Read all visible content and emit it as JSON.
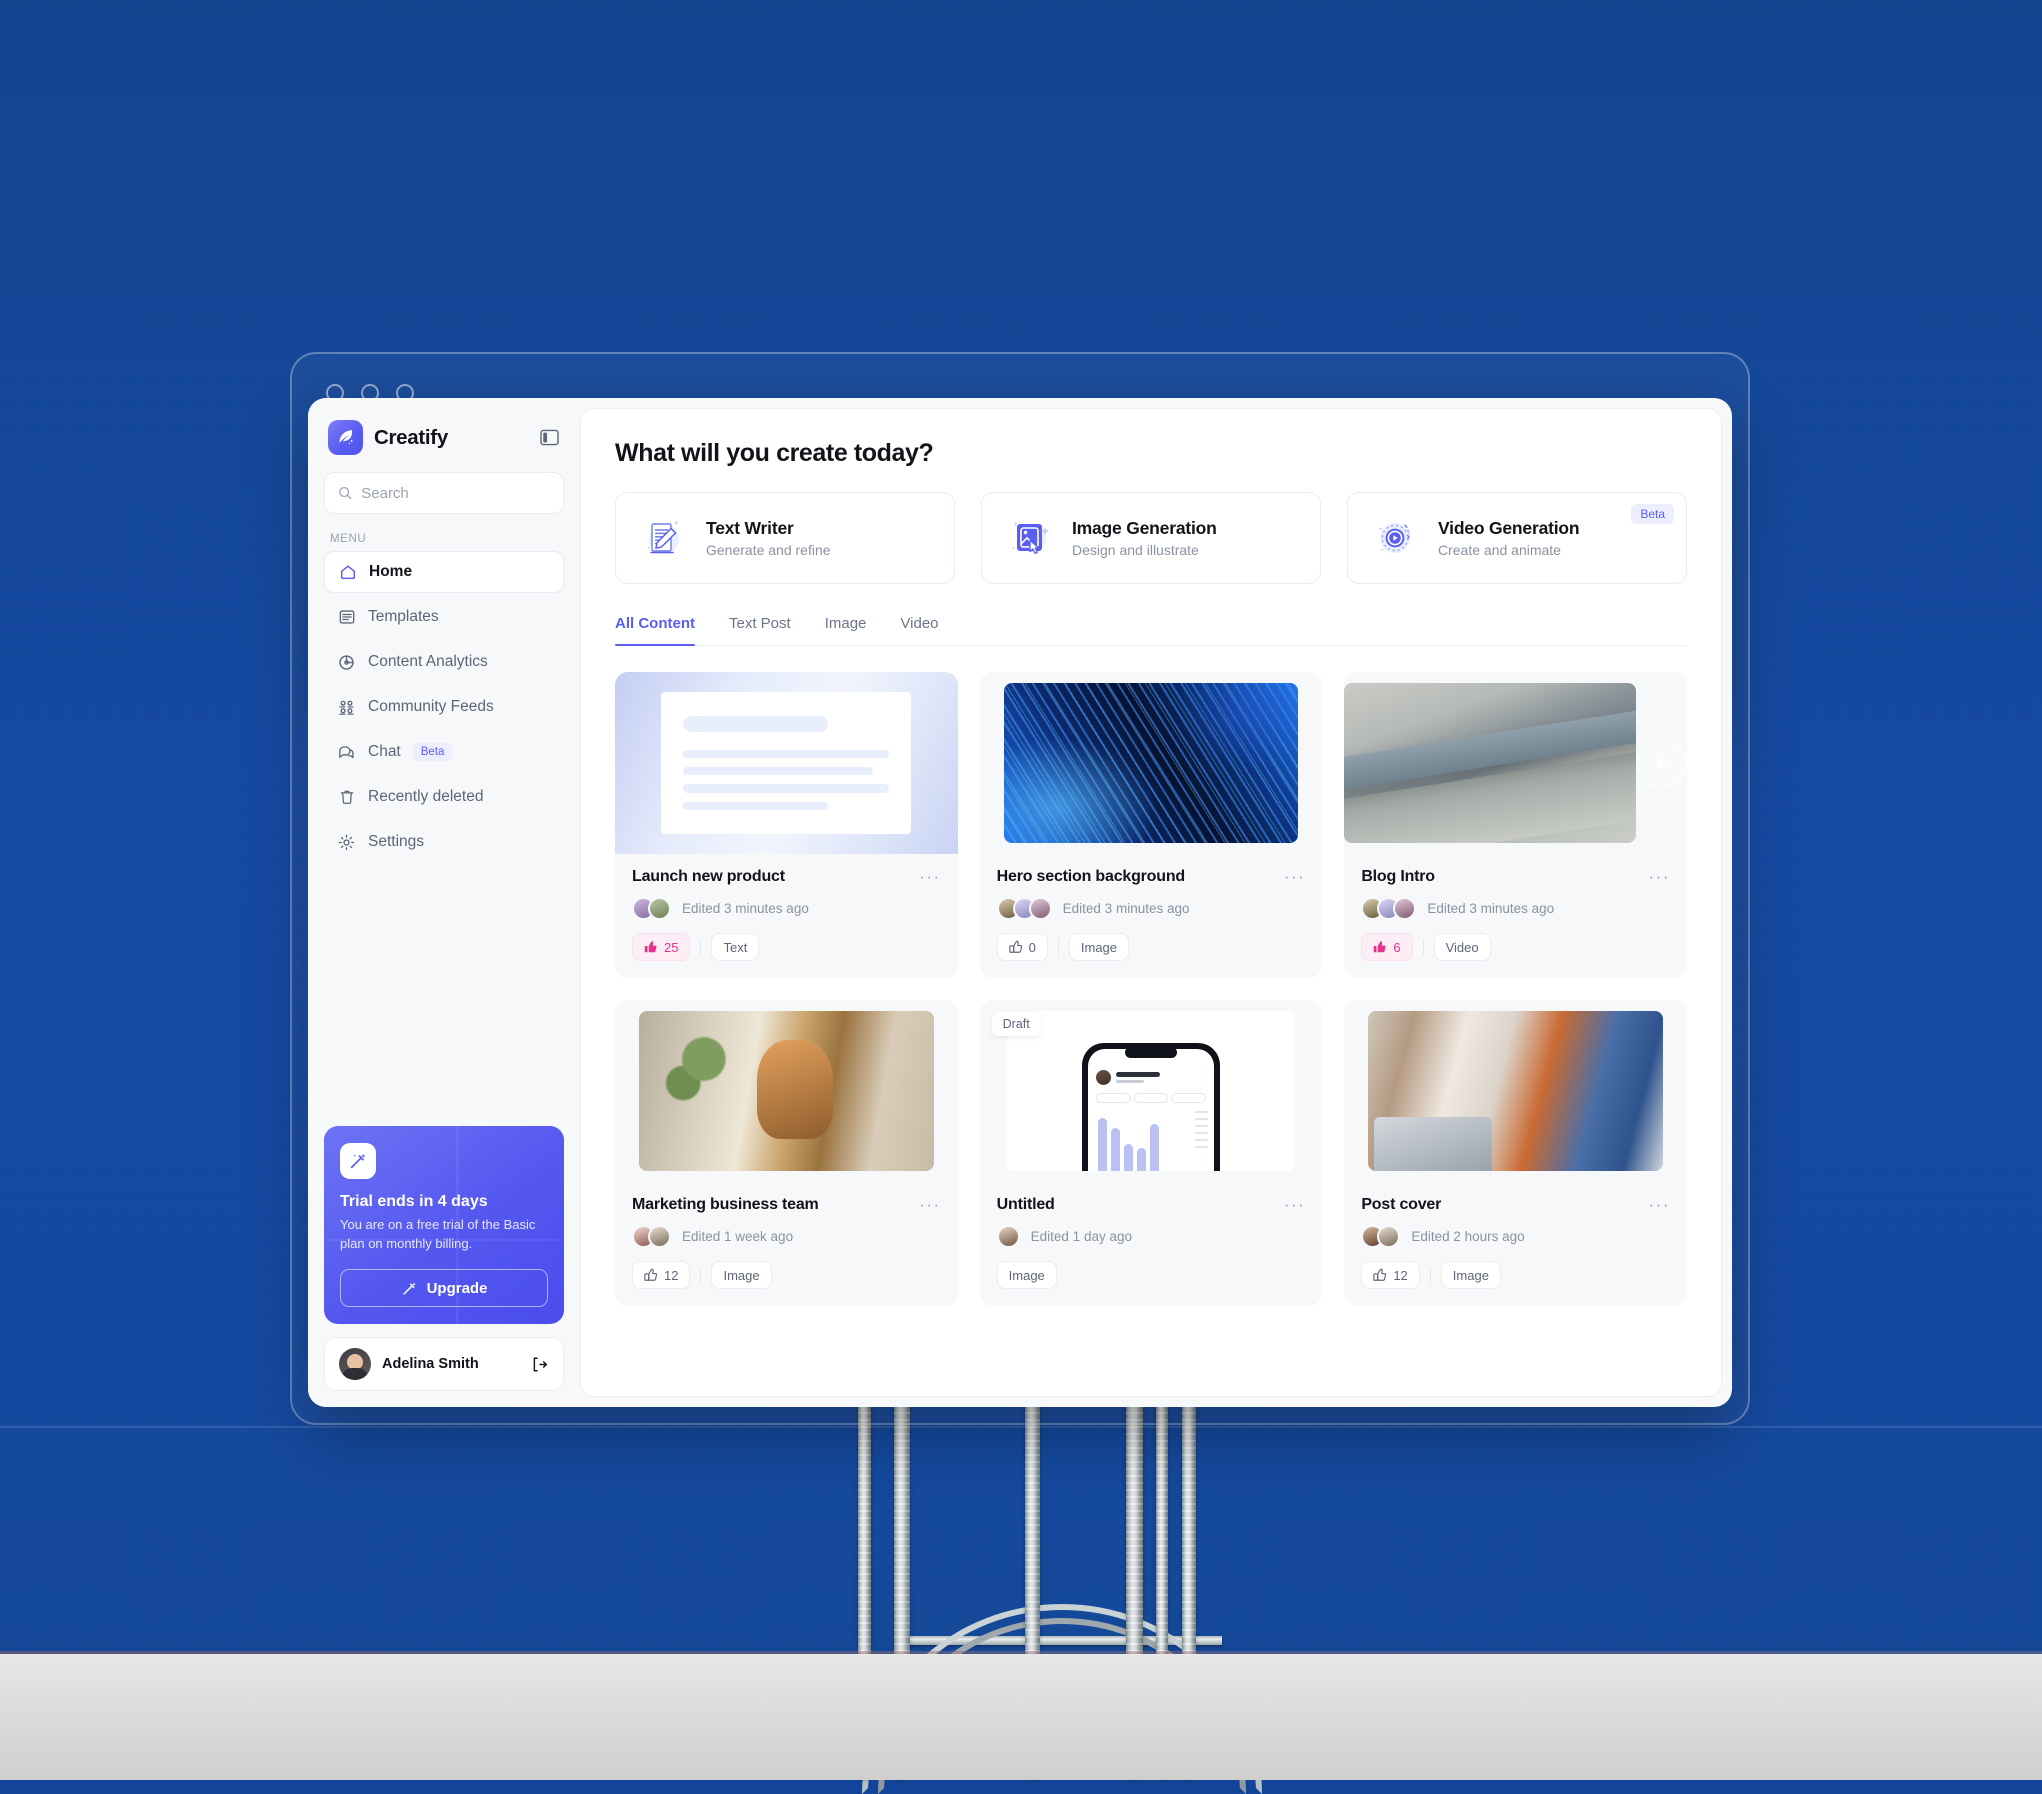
{
  "window": {
    "traffic_lights": [
      "dot-1",
      "dot-2",
      "dot-3"
    ]
  },
  "sidebar": {
    "brand": {
      "name": "Creatify",
      "logo_icon": "feather-quill-icon",
      "toggle_icon": "panel-collapse-icon"
    },
    "search": {
      "placeholder": "Search",
      "value": "",
      "icon": "search-icon"
    },
    "menu_label": "MENU",
    "items": [
      {
        "label": "Home",
        "icon": "home-icon",
        "active": true
      },
      {
        "label": "Templates",
        "icon": "templates-icon",
        "active": false
      },
      {
        "label": "Content Analytics",
        "icon": "analytics-pie-icon",
        "active": false
      },
      {
        "label": "Community Feeds",
        "icon": "community-people-icon",
        "active": false
      },
      {
        "label": "Chat",
        "icon": "chat-bubble-icon",
        "active": false,
        "badge": "Beta"
      },
      {
        "label": "Recently deleted",
        "icon": "trash-icon",
        "active": false
      },
      {
        "label": "Settings",
        "icon": "gear-icon",
        "active": false
      }
    ],
    "trial": {
      "icon": "magic-wand-icon",
      "title": "Trial ends in 4 days",
      "subtitle": "You are on a free trial of the Basic plan on monthly billing.",
      "button_label": "Upgrade",
      "button_icon": "magic-wand-icon"
    },
    "user": {
      "name": "Adelina Smith",
      "avatar": "user-avatar",
      "logout_icon": "logout-icon"
    }
  },
  "main": {
    "page_title": "What will you create today?",
    "actions": [
      {
        "title": "Text Writer",
        "subtitle": "Generate and refine",
        "icon": "document-pen-icon",
        "badge": null
      },
      {
        "title": "Image Generation",
        "subtitle": "Design and illustrate",
        "icon": "image-cursor-icon",
        "badge": null
      },
      {
        "title": "Video Generation",
        "subtitle": "Create and animate",
        "icon": "video-play-icon",
        "badge": "Beta"
      }
    ],
    "tabs": [
      {
        "label": "All Content",
        "active": true
      },
      {
        "label": "Text Post",
        "active": false
      },
      {
        "label": "Image",
        "active": false
      },
      {
        "label": "Video",
        "active": false
      }
    ],
    "cards": [
      {
        "title": "Launch new product",
        "edited": "Edited 3 minutes ago",
        "likes": "25",
        "liked": true,
        "type_label": "Text",
        "thumb": "text-document-placeholder",
        "draft": null,
        "avatars": 2,
        "more_icon": "more-horizontal-icon"
      },
      {
        "title": "Hero section background",
        "edited": "Edited 3 minutes ago",
        "likes": "0",
        "liked": false,
        "type_label": "Image",
        "thumb": "abstract-blue-streaks",
        "draft": null,
        "avatars": 3,
        "more_icon": "more-horizontal-icon"
      },
      {
        "title": "Blog Intro",
        "edited": "Edited 3 minutes ago",
        "likes": "6",
        "liked": true,
        "type_label": "Video",
        "thumb": "grey-3d-render-video",
        "draft": null,
        "avatars": 3,
        "more_icon": "more-horizontal-icon"
      },
      {
        "title": "Marketing business team",
        "edited": "Edited 1 week ago",
        "likes": "12",
        "liked": false,
        "type_label": "Image",
        "thumb": "office-team-photo",
        "draft": null,
        "avatars": 2,
        "more_icon": "more-horizontal-icon"
      },
      {
        "title": "Untitled",
        "edited": "Edited 1 day ago",
        "likes": null,
        "liked": false,
        "type_label": "Image",
        "thumb": "phone-mockup-chart",
        "draft": "Draft",
        "avatars": 1,
        "more_icon": "more-horizontal-icon"
      },
      {
        "title": "Post cover",
        "edited": "Edited 2 hours ago",
        "likes": "12",
        "liked": false,
        "type_label": "Image",
        "thumb": "couple-laptop-photo",
        "draft": null,
        "avatars": 2,
        "more_icon": "more-horizontal-icon"
      }
    ]
  },
  "colors": {
    "background_blue": "#12459a",
    "accent_indigo": "#5b5ef0",
    "liked_pink": "#e7318f",
    "surface": "#f7f8fa"
  }
}
